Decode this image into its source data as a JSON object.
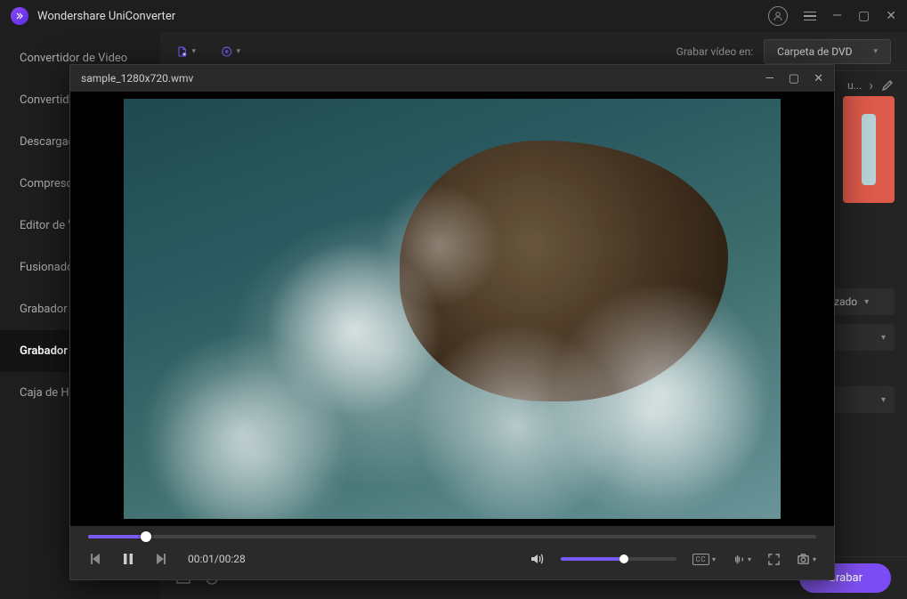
{
  "app": {
    "title": "Wondershare UniConverter"
  },
  "sidebar": {
    "items": [
      {
        "label": "Convertidor de Video"
      },
      {
        "label": "Convertidor"
      },
      {
        "label": "Descargador"
      },
      {
        "label": "Compresor"
      },
      {
        "label": "Editor de Video"
      },
      {
        "label": "Fusionador"
      },
      {
        "label": "Grabador"
      },
      {
        "label": "Grabador"
      },
      {
        "label": "Caja de Herramientas"
      }
    ],
    "activeIndex": 7
  },
  "toolbar": {
    "recordLabel": "Grabar vídeo en:",
    "destDropdown": "Carpeta de DVD"
  },
  "rightpanel": {
    "truncated": "u...",
    "optTrunc": "zado"
  },
  "footer": {
    "grabarBtn": "Grabar"
  },
  "player": {
    "filename": "sample_1280x720.wmv",
    "currentTime": "00:01",
    "duration": "00:28",
    "seekPercent": 8,
    "volumePercent": 55,
    "ccLabel": "CC"
  }
}
